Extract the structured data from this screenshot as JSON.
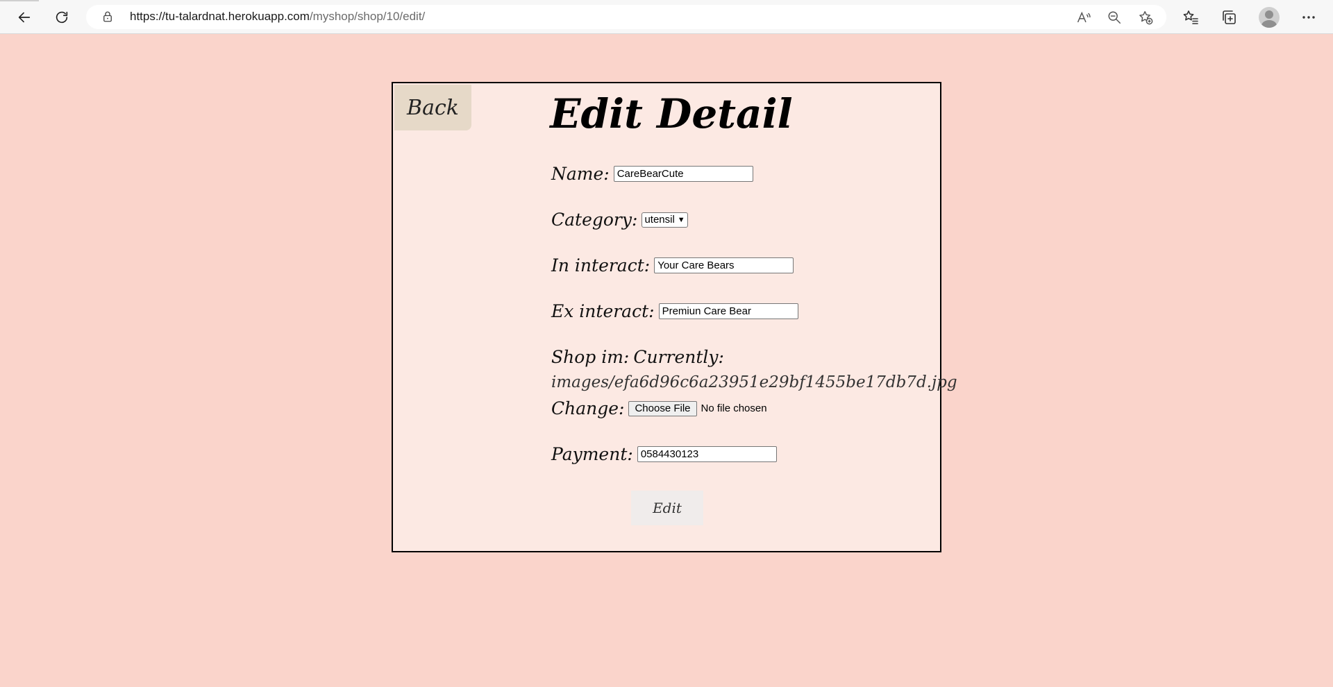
{
  "browser": {
    "url_host": "https://tu-talardnat.herokuapp.com",
    "url_path": "/myshop/shop/10/edit/"
  },
  "page": {
    "back_label": "Back",
    "title": "Edit Detail",
    "submit_label": "Edit"
  },
  "form": {
    "name": {
      "label": "Name:",
      "value": "CareBearCute"
    },
    "category": {
      "label": "Category:",
      "value": "utensil"
    },
    "in_interact": {
      "label": "In interact:",
      "value": "Your Care Bears"
    },
    "ex_interact": {
      "label": "Ex interact:",
      "value": "Premiun Care Bear"
    },
    "shop_im": {
      "label": "Shop im:",
      "currently_label": "Currently:",
      "current_path": "images/efa6d96c6a23951e29bf1455be17db7d.jpg",
      "change_label": "Change:",
      "choose_file_label": "Choose File",
      "file_status": "No file chosen"
    },
    "payment": {
      "label": "Payment:",
      "value": "0584430123"
    }
  }
}
